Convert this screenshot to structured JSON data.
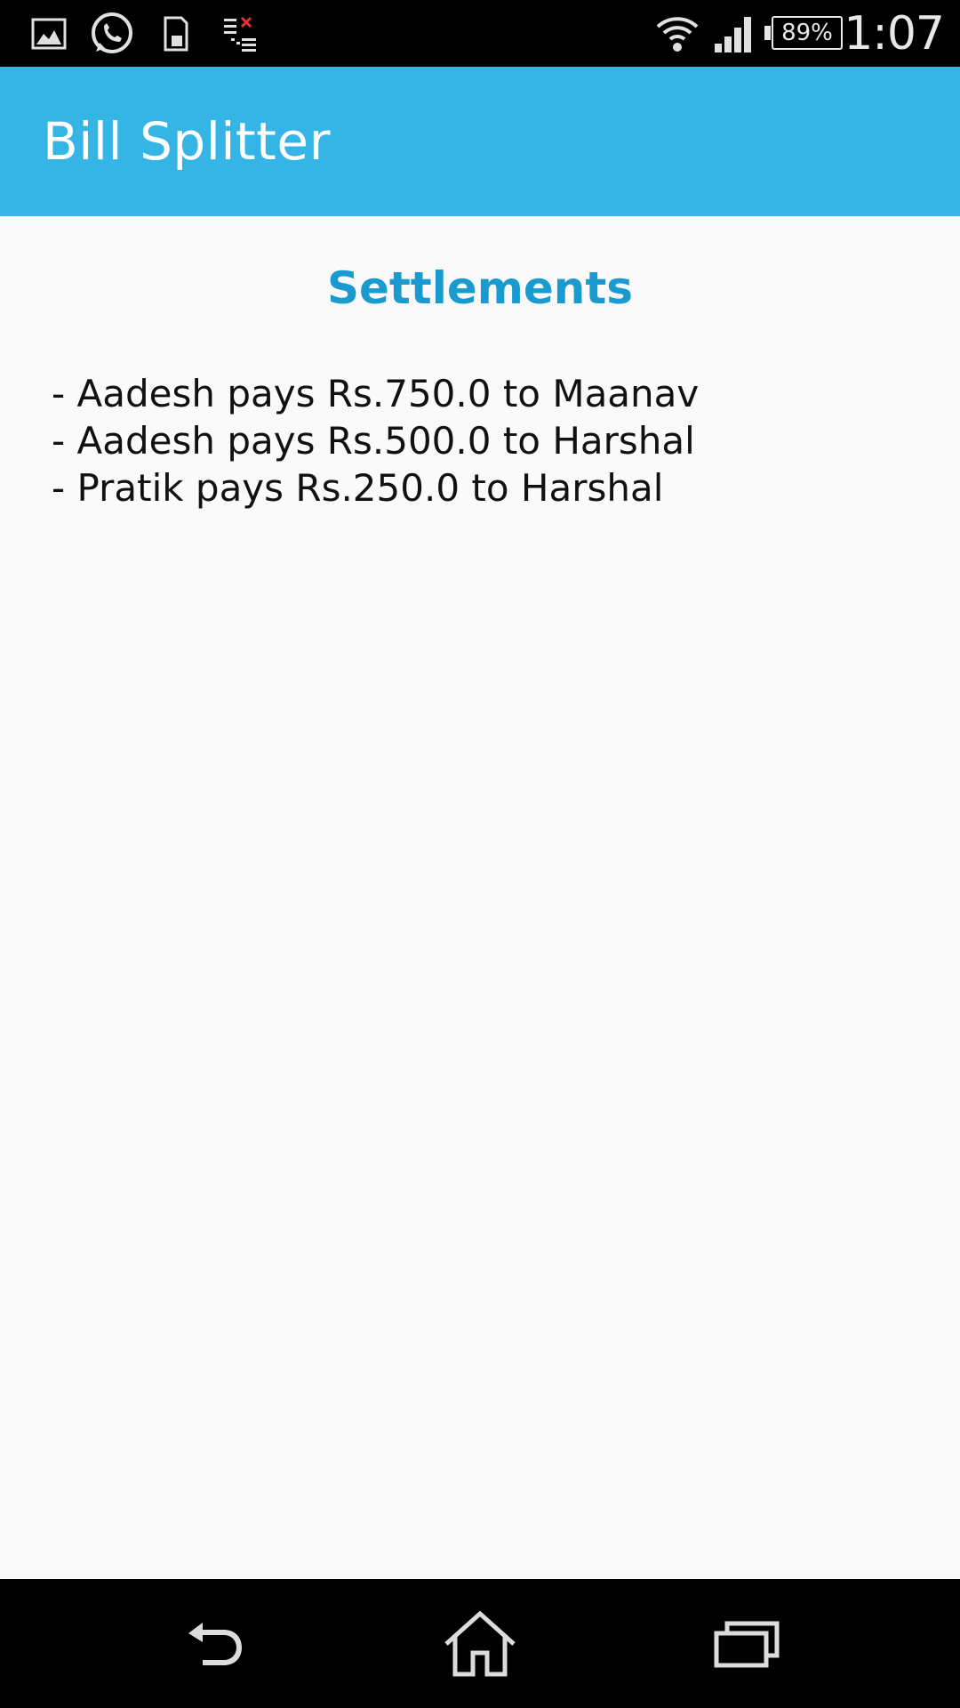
{
  "status_bar": {
    "time": "1:07",
    "battery_percent": "89%",
    "icons": [
      "image-icon",
      "whatsapp-icon",
      "sd-card-icon",
      "sync-error-icon",
      "wifi-icon",
      "cell-signal-icon",
      "battery-icon"
    ]
  },
  "app_bar": {
    "title": "Bill Splitter",
    "color": "#35b5e5"
  },
  "main": {
    "heading": "Settlements",
    "heading_color": "#1a9bd0",
    "settlements": [
      "- Aadesh pays Rs.750.0 to Maanav",
      "- Aadesh pays Rs.500.0 to Harshal",
      "- Pratik pays Rs.250.0 to Harshal"
    ]
  },
  "nav_bar": {
    "buttons": [
      "back-icon",
      "home-icon",
      "recents-icon"
    ]
  }
}
